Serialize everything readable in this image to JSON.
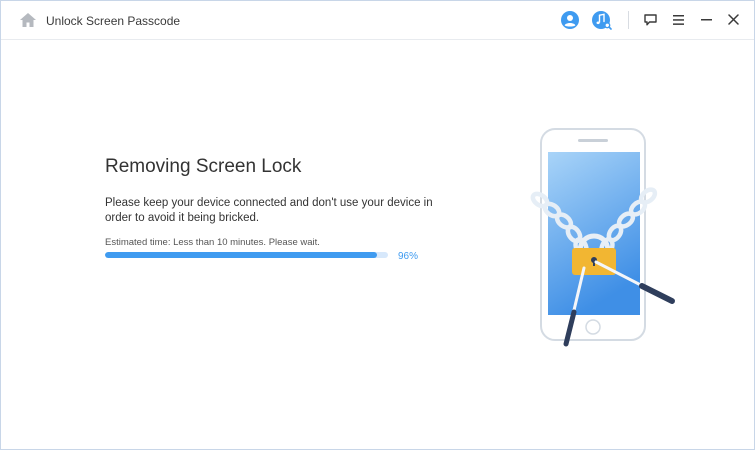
{
  "titlebar": {
    "title": "Unlock Screen Passcode",
    "icons": {
      "home": "home-icon",
      "account": "account-icon",
      "music_search": "music-search-icon",
      "feedback": "feedback-icon",
      "menu": "menu-icon",
      "minimize": "minimize-icon",
      "close": "close-icon"
    }
  },
  "main": {
    "heading": "Removing Screen Lock",
    "description": "Please keep your device connected and don't use your device in order to avoid it being bricked.",
    "estimate": "Estimated time: Less than 10 minutes. Please wait.",
    "progress": {
      "percent_label": "96%",
      "fraction": 0.96
    }
  },
  "colors": {
    "accent": "#3f9bf0",
    "progress_track": "#d7e8fb",
    "lock": "#f2b632",
    "screen_top": "#a9d4f8",
    "screen_bottom": "#3f8fe6",
    "tool": "#2f3e5c"
  }
}
